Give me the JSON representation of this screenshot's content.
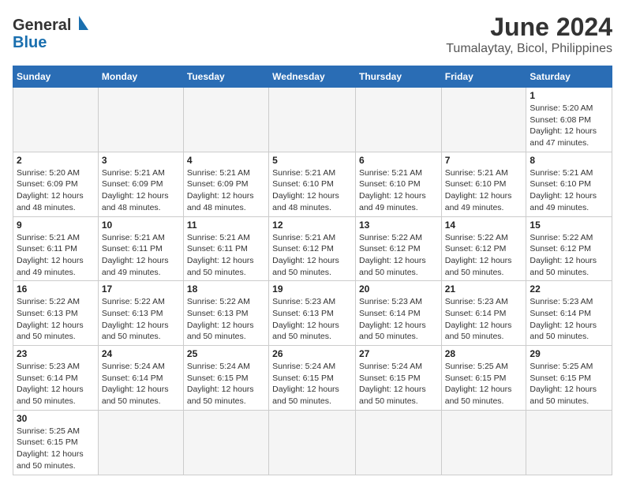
{
  "header": {
    "logo_general": "General",
    "logo_blue": "Blue",
    "month_title": "June 2024",
    "location": "Tumalaytay, Bicol, Philippines"
  },
  "days_of_week": [
    "Sunday",
    "Monday",
    "Tuesday",
    "Wednesday",
    "Thursday",
    "Friday",
    "Saturday"
  ],
  "weeks": [
    [
      {
        "day": "",
        "info": ""
      },
      {
        "day": "",
        "info": ""
      },
      {
        "day": "",
        "info": ""
      },
      {
        "day": "",
        "info": ""
      },
      {
        "day": "",
        "info": ""
      },
      {
        "day": "",
        "info": ""
      },
      {
        "day": "1",
        "info": "Sunrise: 5:20 AM\nSunset: 6:08 PM\nDaylight: 12 hours and 47 minutes."
      }
    ],
    [
      {
        "day": "2",
        "info": "Sunrise: 5:20 AM\nSunset: 6:09 PM\nDaylight: 12 hours and 48 minutes."
      },
      {
        "day": "3",
        "info": "Sunrise: 5:21 AM\nSunset: 6:09 PM\nDaylight: 12 hours and 48 minutes."
      },
      {
        "day": "4",
        "info": "Sunrise: 5:21 AM\nSunset: 6:09 PM\nDaylight: 12 hours and 48 minutes."
      },
      {
        "day": "5",
        "info": "Sunrise: 5:21 AM\nSunset: 6:10 PM\nDaylight: 12 hours and 48 minutes."
      },
      {
        "day": "6",
        "info": "Sunrise: 5:21 AM\nSunset: 6:10 PM\nDaylight: 12 hours and 49 minutes."
      },
      {
        "day": "7",
        "info": "Sunrise: 5:21 AM\nSunset: 6:10 PM\nDaylight: 12 hours and 49 minutes."
      },
      {
        "day": "8",
        "info": "Sunrise: 5:21 AM\nSunset: 6:10 PM\nDaylight: 12 hours and 49 minutes."
      }
    ],
    [
      {
        "day": "9",
        "info": "Sunrise: 5:21 AM\nSunset: 6:11 PM\nDaylight: 12 hours and 49 minutes."
      },
      {
        "day": "10",
        "info": "Sunrise: 5:21 AM\nSunset: 6:11 PM\nDaylight: 12 hours and 49 minutes."
      },
      {
        "day": "11",
        "info": "Sunrise: 5:21 AM\nSunset: 6:11 PM\nDaylight: 12 hours and 50 minutes."
      },
      {
        "day": "12",
        "info": "Sunrise: 5:21 AM\nSunset: 6:12 PM\nDaylight: 12 hours and 50 minutes."
      },
      {
        "day": "13",
        "info": "Sunrise: 5:22 AM\nSunset: 6:12 PM\nDaylight: 12 hours and 50 minutes."
      },
      {
        "day": "14",
        "info": "Sunrise: 5:22 AM\nSunset: 6:12 PM\nDaylight: 12 hours and 50 minutes."
      },
      {
        "day": "15",
        "info": "Sunrise: 5:22 AM\nSunset: 6:12 PM\nDaylight: 12 hours and 50 minutes."
      }
    ],
    [
      {
        "day": "16",
        "info": "Sunrise: 5:22 AM\nSunset: 6:13 PM\nDaylight: 12 hours and 50 minutes."
      },
      {
        "day": "17",
        "info": "Sunrise: 5:22 AM\nSunset: 6:13 PM\nDaylight: 12 hours and 50 minutes."
      },
      {
        "day": "18",
        "info": "Sunrise: 5:22 AM\nSunset: 6:13 PM\nDaylight: 12 hours and 50 minutes."
      },
      {
        "day": "19",
        "info": "Sunrise: 5:23 AM\nSunset: 6:13 PM\nDaylight: 12 hours and 50 minutes."
      },
      {
        "day": "20",
        "info": "Sunrise: 5:23 AM\nSunset: 6:14 PM\nDaylight: 12 hours and 50 minutes."
      },
      {
        "day": "21",
        "info": "Sunrise: 5:23 AM\nSunset: 6:14 PM\nDaylight: 12 hours and 50 minutes."
      },
      {
        "day": "22",
        "info": "Sunrise: 5:23 AM\nSunset: 6:14 PM\nDaylight: 12 hours and 50 minutes."
      }
    ],
    [
      {
        "day": "23",
        "info": "Sunrise: 5:23 AM\nSunset: 6:14 PM\nDaylight: 12 hours and 50 minutes."
      },
      {
        "day": "24",
        "info": "Sunrise: 5:24 AM\nSunset: 6:14 PM\nDaylight: 12 hours and 50 minutes."
      },
      {
        "day": "25",
        "info": "Sunrise: 5:24 AM\nSunset: 6:15 PM\nDaylight: 12 hours and 50 minutes."
      },
      {
        "day": "26",
        "info": "Sunrise: 5:24 AM\nSunset: 6:15 PM\nDaylight: 12 hours and 50 minutes."
      },
      {
        "day": "27",
        "info": "Sunrise: 5:24 AM\nSunset: 6:15 PM\nDaylight: 12 hours and 50 minutes."
      },
      {
        "day": "28",
        "info": "Sunrise: 5:25 AM\nSunset: 6:15 PM\nDaylight: 12 hours and 50 minutes."
      },
      {
        "day": "29",
        "info": "Sunrise: 5:25 AM\nSunset: 6:15 PM\nDaylight: 12 hours and 50 minutes."
      }
    ],
    [
      {
        "day": "30",
        "info": "Sunrise: 5:25 AM\nSunset: 6:15 PM\nDaylight: 12 hours and 50 minutes."
      },
      {
        "day": "",
        "info": ""
      },
      {
        "day": "",
        "info": ""
      },
      {
        "day": "",
        "info": ""
      },
      {
        "day": "",
        "info": ""
      },
      {
        "day": "",
        "info": ""
      },
      {
        "day": "",
        "info": ""
      }
    ]
  ]
}
